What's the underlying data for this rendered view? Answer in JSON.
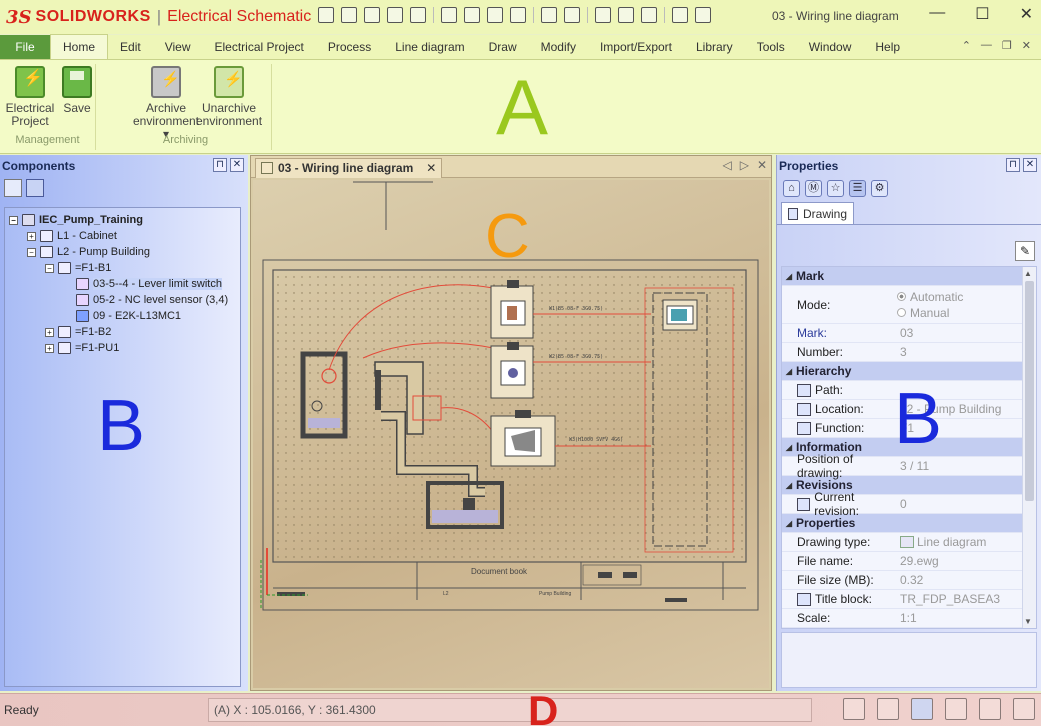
{
  "app": {
    "brand": "SOLIDWORKS",
    "product": "Electrical Schematic",
    "doc_title": "03 - Wiring line diagram"
  },
  "window_controls": {
    "minimize": "—",
    "maximize": "☐",
    "close": "✕"
  },
  "menu": {
    "file": "File",
    "tabs": [
      "Home",
      "Edit",
      "View",
      "Electrical Project",
      "Process",
      "Line diagram",
      "Draw",
      "Modify",
      "Import/Export",
      "Library",
      "Tools",
      "Window",
      "Help"
    ],
    "active": "Home"
  },
  "ribbon": {
    "groups": [
      {
        "label": "Management",
        "buttons": [
          {
            "line1": "Electrical",
            "line2": "Project"
          },
          {
            "line1": "Save",
            "line2": ""
          }
        ]
      },
      {
        "label": "Archiving",
        "buttons": [
          {
            "line1": "Archive",
            "line2": "environment ▾"
          },
          {
            "line1": "Unarchive",
            "line2": "environment"
          }
        ]
      }
    ]
  },
  "annotations": {
    "a": "A",
    "b1": "B",
    "b2": "B",
    "c": "C",
    "d": "D"
  },
  "components": {
    "title": "Components",
    "tree": [
      {
        "label": "IEC_Pump_Training",
        "level": 0,
        "exp": "−",
        "icon": "project",
        "bold": true
      },
      {
        "label": "L1 - Cabinet",
        "level": 1,
        "exp": "+",
        "icon": "cabinet"
      },
      {
        "label": "L2 - Pump Building",
        "level": 1,
        "exp": "−",
        "icon": "location"
      },
      {
        "label": "=F1-B1",
        "level": 2,
        "exp": "−",
        "icon": "component"
      },
      {
        "label": "03-5--4 - Lever limit switch",
        "level": 3,
        "exp": "",
        "icon": "symbol",
        "selected": true
      },
      {
        "label": "05-2 - NC level sensor (3,4)",
        "level": 3,
        "exp": "",
        "icon": "symbol"
      },
      {
        "label": "09 - E2K-L13MC1",
        "level": 3,
        "exp": "",
        "icon": "part"
      },
      {
        "label": "=F1-B2",
        "level": 2,
        "exp": "+",
        "icon": "component"
      },
      {
        "label": "=F1-PU1",
        "level": 2,
        "exp": "+",
        "icon": "component"
      }
    ]
  },
  "drawing": {
    "tab_label": "03 - Wiring line diagram",
    "title_block_text": "Document book",
    "title_block_sub": "Pump Building",
    "title_block_num": "L2",
    "wire_labels": [
      "W1(B5 08-F 3G0.75)",
      "W2(B5 08-F 3G0.75)",
      "W3(H1000 SVFV 4G6)"
    ]
  },
  "properties": {
    "title": "Properties",
    "tab": "Drawing",
    "sections": [
      {
        "name": "Mark",
        "rows": [
          {
            "key": "Mode:",
            "type": "radio",
            "options": [
              "Automatic",
              "Manual"
            ],
            "selected": 0
          },
          {
            "key": "Mark:",
            "value": "03",
            "link": true
          },
          {
            "key": "Number:",
            "value": "3"
          }
        ]
      },
      {
        "name": "Hierarchy",
        "rows": [
          {
            "key": "Path:",
            "value": "",
            "icon": true
          },
          {
            "key": "Location:",
            "value": "L2 - Pump Building",
            "icon": true
          },
          {
            "key": "Function:",
            "value": "F1",
            "icon": true
          }
        ]
      },
      {
        "name": "Information",
        "rows": [
          {
            "key": "Position of drawing:",
            "value": "3 / 11"
          }
        ]
      },
      {
        "name": "Revisions",
        "rows": [
          {
            "key": "Current revision:",
            "value": "0",
            "icon": true
          }
        ]
      },
      {
        "name": "Properties",
        "rows": [
          {
            "key": "Drawing type:",
            "value": "Line diagram",
            "vicon": true
          },
          {
            "key": "File name:",
            "value": "29.ewg"
          },
          {
            "key": "File size (MB):",
            "value": "0.32"
          },
          {
            "key": "Title block:",
            "value": "TR_FDP_BASEA3",
            "icon": true
          },
          {
            "key": "Scale:",
            "value": "1:1"
          }
        ]
      }
    ]
  },
  "status": {
    "ready": "Ready",
    "coords": "(A) X : 105.0166, Y : 361.4300"
  },
  "colors": {
    "accent_green": "#5b9a3c",
    "annotation_green": "#9ac81e",
    "annotation_blue": "#1a2adc",
    "annotation_orange": "#f59a0f",
    "annotation_red": "#d8231c",
    "wire_red": "#e34b3a"
  }
}
